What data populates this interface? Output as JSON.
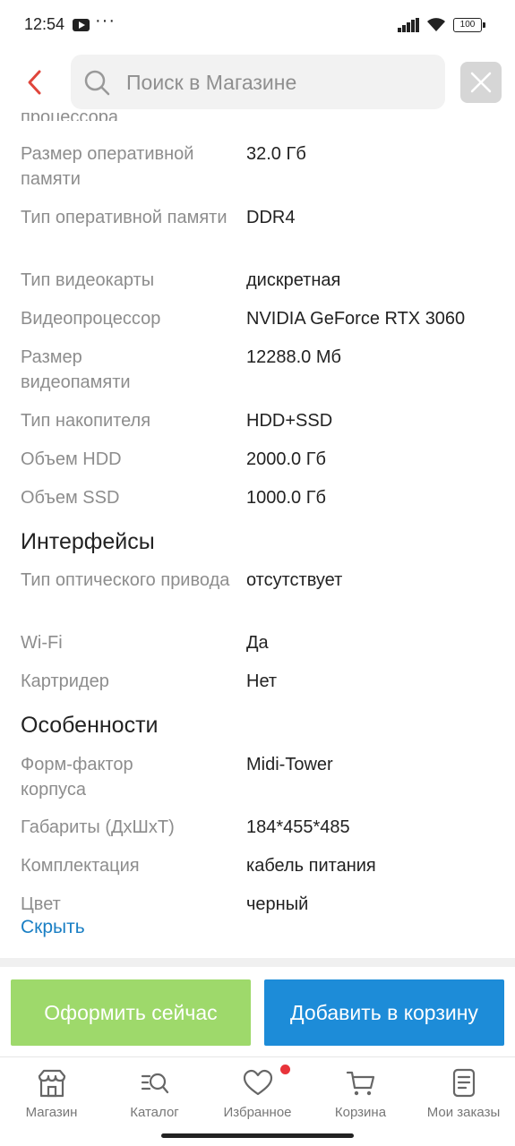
{
  "status_bar": {
    "time": "12:54",
    "dots": "···",
    "battery": "100"
  },
  "search": {
    "placeholder": "Поиск в Магазине"
  },
  "partial_row_label": "процессора",
  "specs_top": [
    {
      "label": "Размер оперативной памяти",
      "value": "32.0 Гб"
    },
    {
      "label": "Тип оперативной памяти",
      "value": "DDR4"
    },
    {
      "label": "Тип видеокарты",
      "value": "дискретная"
    },
    {
      "label": "Видеопроцессор",
      "value": "NVIDIA GeForce RTX 3060"
    },
    {
      "label": "Размер видеопамяти",
      "value": "12288.0 Мб"
    },
    {
      "label": "Тип накопителя",
      "value": "HDD+SSD"
    },
    {
      "label": "Объем HDD",
      "value": "2000.0 Гб"
    },
    {
      "label": "Объем SSD",
      "value": "1000.0 Гб"
    }
  ],
  "section_interfaces": "Интерфейсы",
  "specs_interfaces": [
    {
      "label": "Тип оптического привода",
      "value": "отсутствует"
    },
    {
      "label": "Wi-Fi",
      "value": "Да"
    },
    {
      "label": "Картридер",
      "value": "Нет"
    }
  ],
  "section_features": "Особенности",
  "specs_features": [
    {
      "label": "Форм-фактор корпуса",
      "value": "Midi-Tower"
    },
    {
      "label": "Габариты (ДхШхТ)",
      "value": "184*455*485"
    },
    {
      "label": "Комплектация",
      "value": "кабель питания"
    },
    {
      "label": "Цвет",
      "value": "черный"
    }
  ],
  "hide_link": "Скрыть",
  "actions": {
    "buy_now": "Оформить сейчас",
    "add_to_cart": "Добавить в корзину"
  },
  "nav": [
    {
      "label": "Магазин",
      "icon": "store-icon"
    },
    {
      "label": "Каталог",
      "icon": "catalog-search-icon"
    },
    {
      "label": "Избранное",
      "icon": "heart-icon"
    },
    {
      "label": "Корзина",
      "icon": "cart-icon"
    },
    {
      "label": "Мои заказы",
      "icon": "orders-icon"
    }
  ],
  "colors": {
    "accent_red": "#e0453b",
    "buy_now_green": "#9ed96b",
    "add_cart_blue": "#1d8cd8",
    "link_blue": "#1a7fc4"
  }
}
